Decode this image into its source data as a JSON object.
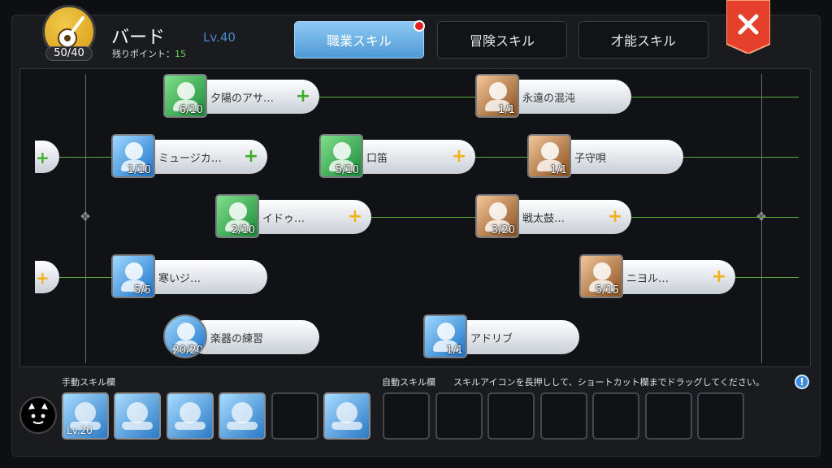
{
  "header": {
    "class_name": "バード",
    "class_level": "Lv.40",
    "class_points": "50/40",
    "remaining_label": "残りポイント：",
    "remaining_value": "15"
  },
  "tabs": [
    {
      "label": "職業スキル",
      "active": true,
      "notification": true
    },
    {
      "label": "冒険スキル",
      "active": false
    },
    {
      "label": "才能スキル",
      "active": false
    }
  ],
  "colors": {
    "accent_blue": "#4f9ad6",
    "link_green": "#5aaa3a",
    "plus_green": "#3fae2a",
    "plus_yellow": "#f0b21a",
    "close_red": "#e5402c"
  },
  "skills": [
    {
      "name": "夕陽のアサ…",
      "level": "6/10",
      "color": "green",
      "plus": "green"
    },
    {
      "name": "永遠の混沌",
      "level": "1/1",
      "color": "brown",
      "plus": "none"
    },
    {
      "name": "ミュージカ…",
      "level": "1/10",
      "color": "blue",
      "plus": "green"
    },
    {
      "name": "口笛",
      "level": "5/10",
      "color": "green",
      "plus": "yellow"
    },
    {
      "name": "子守唄",
      "level": "1/1",
      "color": "brown",
      "plus": "none"
    },
    {
      "name": "イドゥ…",
      "level": "2/10",
      "color": "green",
      "plus": "yellow"
    },
    {
      "name": "戦太鼓…",
      "level": "3/20",
      "color": "brown",
      "plus": "yellow"
    },
    {
      "name": "寒いジ…",
      "level": "5/5",
      "color": "blue",
      "plus": "none"
    },
    {
      "name": "ニヨル…",
      "level": "5/15",
      "color": "brown",
      "plus": "yellow"
    },
    {
      "name": "楽器の練習",
      "level": "20/20",
      "color": "blue",
      "plus": "none"
    },
    {
      "name": "アドリブ",
      "level": "1/1",
      "color": "blue",
      "plus": "none"
    }
  ],
  "bottom": {
    "manual_label": "手動スキル欄",
    "auto_label": "自動スキル欄",
    "instruction": "スキルアイコンを長押しして、ショートカット欄までドラッグしてください。",
    "manual_slot_level": "Lv.20",
    "help_icon": "!"
  },
  "icons": {
    "class": "banjo-icon",
    "close": "close-icon",
    "help": "info-icon",
    "face": "character-face-icon"
  }
}
